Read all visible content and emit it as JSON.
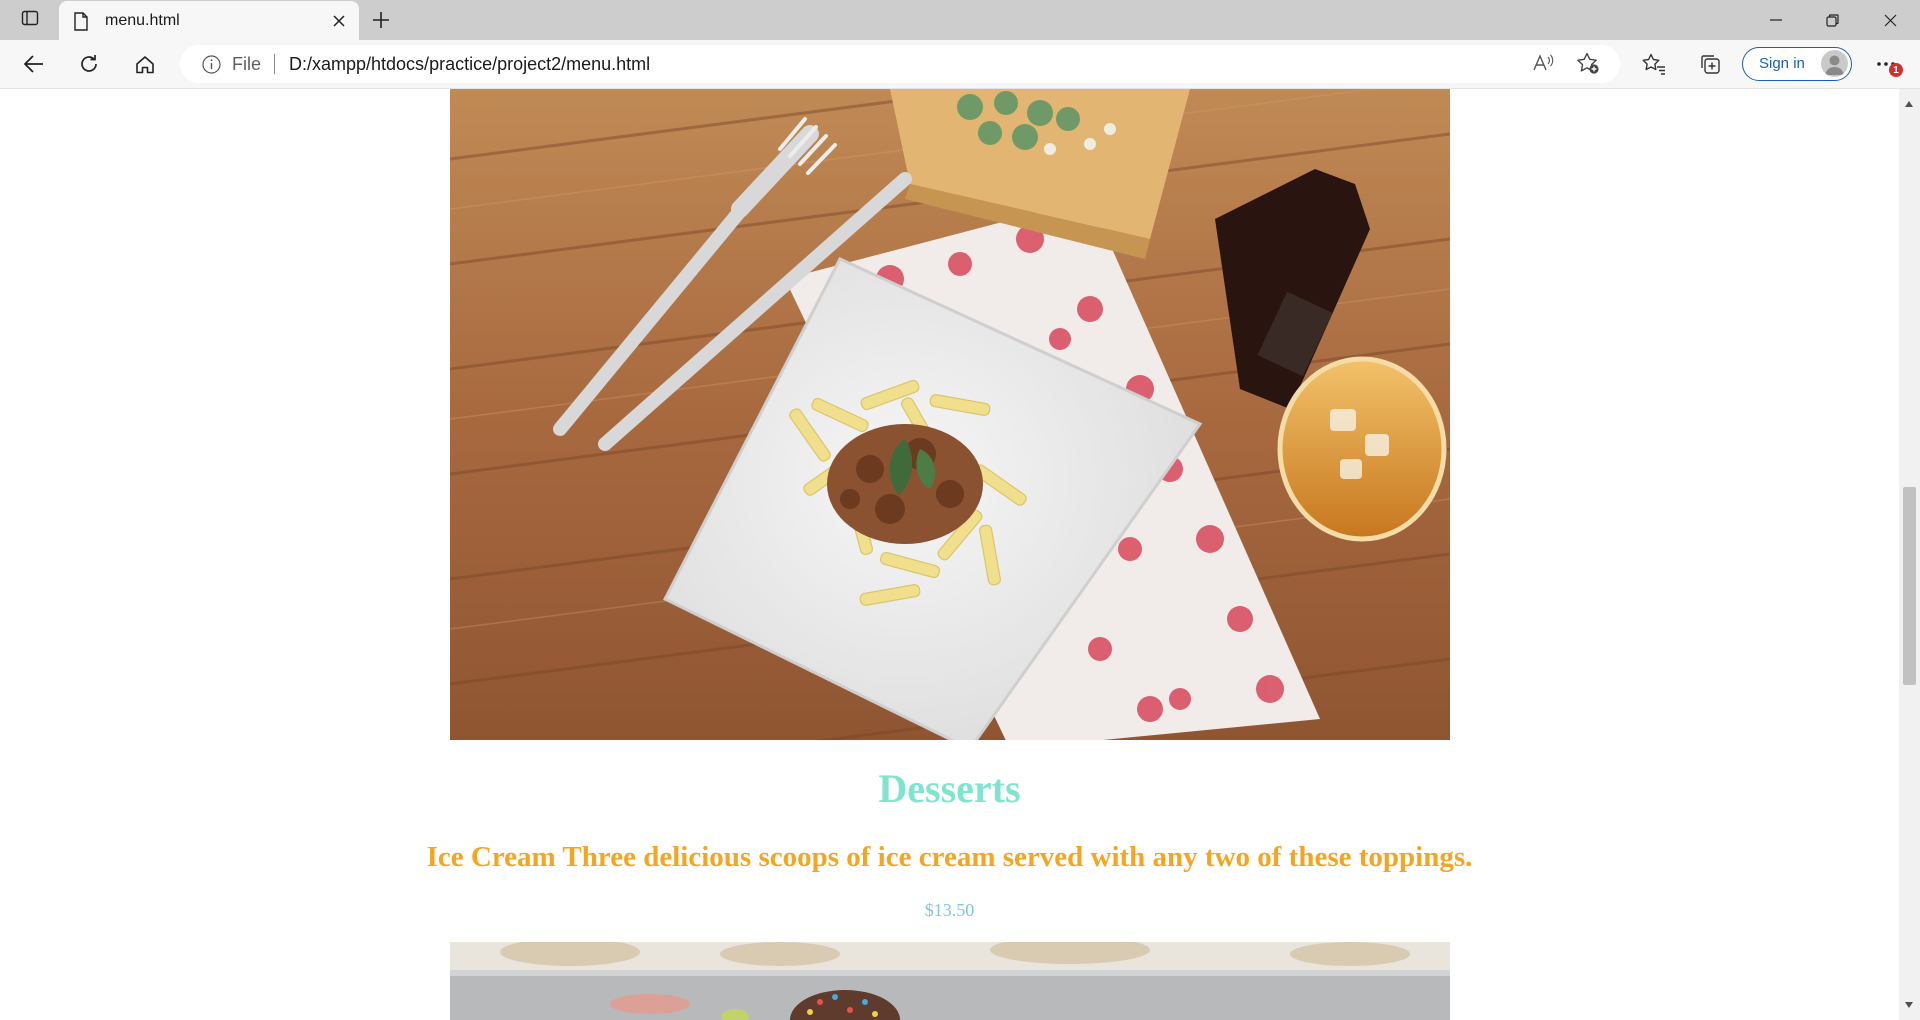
{
  "browser": {
    "tab": {
      "title": "menu.html"
    },
    "address": {
      "scheme": "File",
      "url": "D:/xampp/htdocs/practice/project2/menu.html"
    },
    "signin_label": "Sign in",
    "notification_count": "1"
  },
  "page": {
    "section_title": "Desserts",
    "item_line": "Ice Cream Three delicious scoops of ice cream served with any two of these toppings.",
    "price": "$13.50"
  },
  "colors": {
    "section_title": "#7fe5cf",
    "item_line": "#f5a524",
    "price": "#7ec6da"
  },
  "icons": [
    "tab-actions-icon",
    "document-icon",
    "close-icon",
    "new-tab-icon",
    "minimize-icon",
    "restore-icon",
    "window-close-icon",
    "back-icon",
    "refresh-icon",
    "home-icon",
    "info-icon",
    "read-aloud-icon",
    "add-favorite-icon",
    "favorites-icon",
    "collections-icon",
    "avatar-icon",
    "more-icon"
  ]
}
